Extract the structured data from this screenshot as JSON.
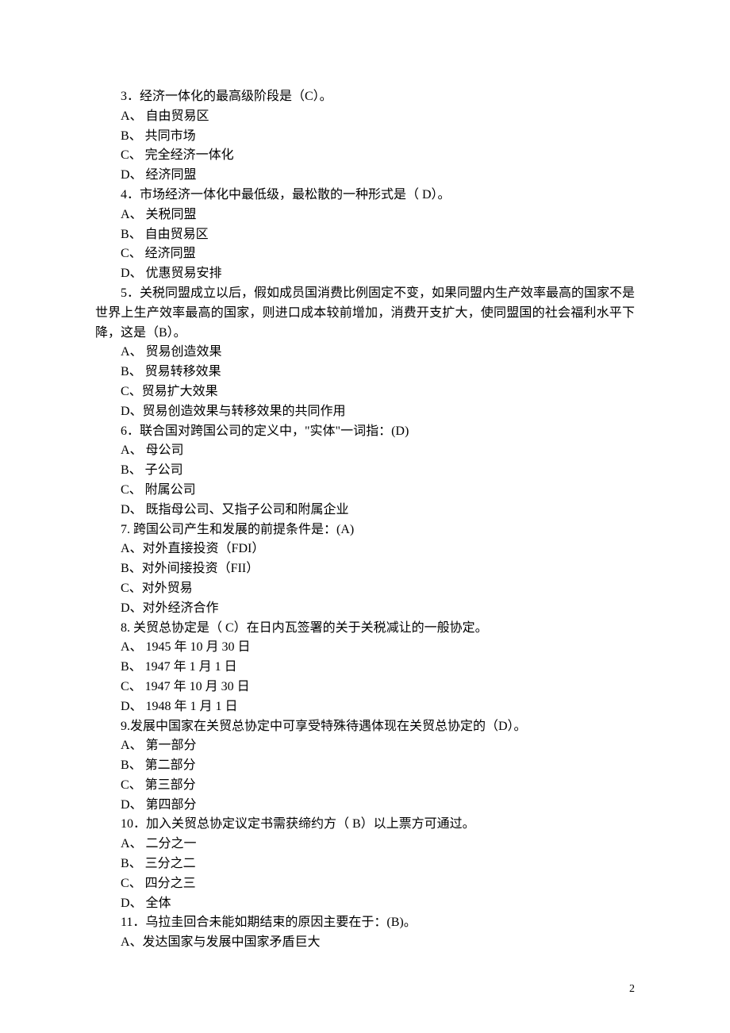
{
  "page_number": "2",
  "questions": [
    {
      "stem": "3．经济一体化的最高级阶段是（C）。",
      "paragraph": false,
      "options": [
        "A、 自由贸易区",
        "B、 共同市场",
        "C、 完全经济一体化",
        "D、 经济同盟"
      ]
    },
    {
      "stem": "4．市场经济一体化中最低级，最松散的一种形式是（ D）。",
      "paragraph": false,
      "options": [
        "A、 关税同盟",
        "B、 自由贸易区",
        "C、 经济同盟",
        "D、 优惠贸易安排"
      ]
    },
    {
      "stem": "5．关税同盟成立以后，假如成员国消费比例固定不变，如果同盟内生产效率最高的国家不是世界上生产效率最高的国家，则进口成本较前增加，消费开支扩大，使同盟国的社会福利水平下降，这是（B）。",
      "paragraph": true,
      "options": [
        "A、 贸易创造效果",
        "B、 贸易转移效果",
        "C、贸易扩大效果",
        "D、贸易创造效果与转移效果的共同作用"
      ]
    },
    {
      "stem": "6．联合国对跨国公司的定义中，\"实体\"一词指：(D)",
      "paragraph": false,
      "options": [
        "A、 母公司",
        "B、 子公司",
        "C、 附属公司",
        "D、 既指母公司、又指子公司和附属企业"
      ]
    },
    {
      "stem": "7. 跨国公司产生和发展的前提条件是：(A)",
      "paragraph": false,
      "options": [
        "A、对外直接投资（FDI）",
        "B、对外间接投资（FII）",
        "C、对外贸易",
        "D、对外经济合作"
      ]
    },
    {
      "stem": "8. 关贸总协定是（ C）在日内瓦签署的关于关税减让的一般协定。",
      "paragraph": false,
      "options": [
        "A、 1945 年 10 月 30 日",
        "B、 1947 年 1 月 1 日",
        "C、 1947 年 10 月 30 日",
        "D、 1948 年 1 月 1 日"
      ]
    },
    {
      "stem": "9.发展中国家在关贸总协定中可享受特殊待遇体现在关贸总协定的（D）。",
      "paragraph": false,
      "options": [
        "A、 第一部分",
        "B、 第二部分",
        "C、 第三部分",
        "D、 第四部分"
      ]
    },
    {
      "stem": "10．加入关贸总协定议定书需获缔约方（ B）以上票方可通过。",
      "paragraph": false,
      "options": [
        "A、 二分之一",
        "B、 三分之二",
        "C、 四分之三",
        "D、 全体"
      ]
    },
    {
      "stem": "11．乌拉圭回合未能如期结束的原因主要在于：(B)。",
      "paragraph": false,
      "options": [
        "A、发达国家与发展中国家矛盾巨大"
      ]
    }
  ]
}
